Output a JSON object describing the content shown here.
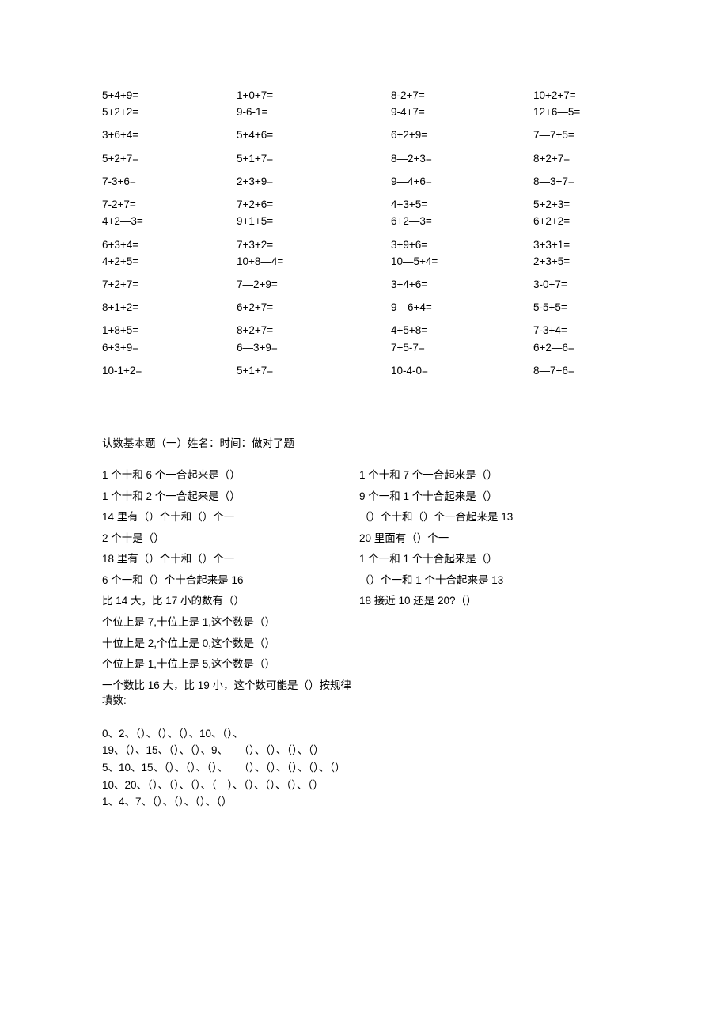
{
  "equations": [
    [
      {
        "c1": "5+4+9=",
        "c2": "1+0+7=",
        "c3": "8-2+7=",
        "c4": "10+2+7="
      },
      {
        "c1": "5+2+2=",
        "c2": "9-6-1=",
        "c3": "9-4+7=",
        "c4": "12+6—5="
      }
    ],
    [
      {
        "c1": "3+6+4=",
        "c2": "5+4+6=",
        "c3": "6+2+9=",
        "c4": "7—7+5="
      }
    ],
    [
      {
        "c1": "5+2+7=",
        "c2": "5+1+7=",
        "c3": "8—2+3=",
        "c4": "8+2+7="
      }
    ],
    [
      {
        "c1": "7-3+6=",
        "c2": "2+3+9=",
        "c3": "9—4+6=",
        "c4": "8—3+7="
      }
    ],
    [
      {
        "c1": "7-2+7=",
        "c2": "7+2+6=",
        "c3": "4+3+5=",
        "c4": "5+2+3="
      },
      {
        "c1": "4+2—3=",
        "c2": "9+1+5=",
        "c3": "6+2—3=",
        "c4": "6+2+2="
      }
    ],
    [
      {
        "c1": "6+3+4=",
        "c2": "7+3+2=",
        "c3": "3+9+6=",
        "c4": "3+3+1="
      },
      {
        "c1": "4+2+5=",
        "c2": "10+8—4=",
        "c3": "10—5+4=",
        "c4": "2+3+5="
      }
    ],
    [
      {
        "c1": "7+2+7=",
        "c2": "7—2+9=",
        "c3": "3+4+6=",
        "c4": "3-0+7="
      }
    ],
    [
      {
        "c1": "8+1+2=",
        "c2": "6+2+7=",
        "c3": "9—6+4=",
        "c4": "5-5+5="
      }
    ],
    [
      {
        "c1": "1+8+5=",
        "c2": "8+2+7=",
        "c3": "4+5+8=",
        "c4": "7-3+4="
      },
      {
        "c1": "6+3+9=",
        "c2": "6—3+9=",
        "c3": "7+5-7=",
        "c4": "6+2—6="
      }
    ],
    [
      {
        "c1": "10-1+2=",
        "c2": "5+1+7=",
        "c3": "10-4-0=",
        "c4": "8—7+6="
      }
    ]
  ],
  "sectionTitle": "认数基本题（一）姓名：时间：做对了题",
  "qa": [
    {
      "l": "1 个十和 6 个一合起来是（）",
      "r": "1 个十和 7 个一合起来是（）"
    },
    {
      "l": "1 个十和 2 个一合起来是（）",
      "r": "9 个一和 1 个十合起来是（）"
    },
    {
      "l": "14 里有（）个十和（）个一",
      "r": "（）个十和（）个一合起来是 13"
    },
    {
      "l": "2 个十是（）",
      "r": "20 里面有（）个一"
    },
    {
      "l": "18 里有（）个十和（）个一",
      "r": "1 个一和 1 个十合起来是（）"
    },
    {
      "l": "6 个一和（）个十合起来是 16",
      "r": "（）个一和 1 个十合起来是 13"
    },
    {
      "l": "比 14 大，比 17 小的数有（）",
      "r": "18 接近 10 还是 20?（）"
    },
    {
      "l": "个位上是 7,十位上是 1,这个数是（）",
      "r": ""
    },
    {
      "l": "十位上是 2,个位上是 0,这个数是（）",
      "r": ""
    },
    {
      "l": "个位上是 1,十位上是 5,这个数是（）",
      "r": ""
    },
    {
      "l": "一个数比 16 大，比 19 小，这个数可能是（）按规律填数:",
      "r": ""
    }
  ],
  "seq": [
    "0、2、（）、（）、（）、10、（）、",
    "19、（）、15、（）、（）、9、 （）、（）、（）、（）",
    "5、10、15、（）、（）、（）、 （）、（）、（）、（）、（）",
    "10、20、（）、（）、（）、（ ）、（）、（）、（）、（）",
    "1、4、7、（）、（）、（）、（）"
  ]
}
